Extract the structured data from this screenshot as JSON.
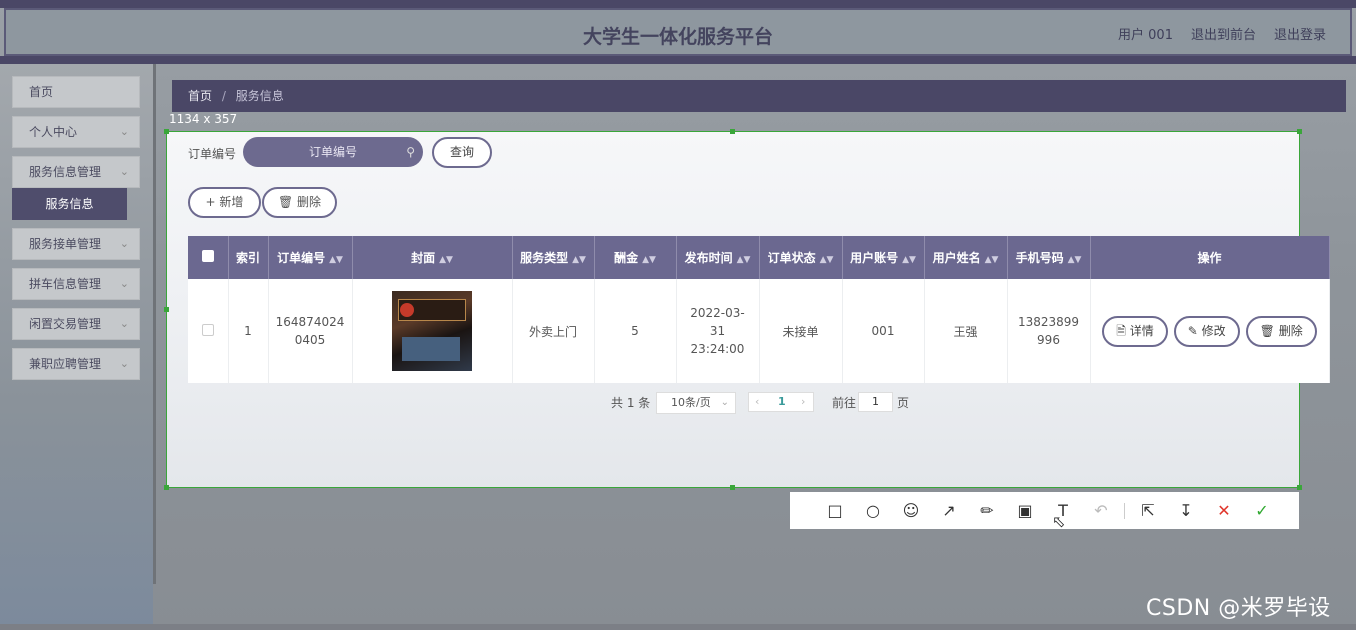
{
  "header": {
    "title": "大学生一体化服务平台",
    "user": "用户 001",
    "front": "退出到前台",
    "logout": "退出登录"
  },
  "sidebar": {
    "items": [
      {
        "label": "首页"
      },
      {
        "label": "个人中心"
      },
      {
        "label": "服务信息管理"
      },
      {
        "label": "服务信息"
      },
      {
        "label": "服务接单管理"
      },
      {
        "label": "拼车信息管理"
      },
      {
        "label": "闲置交易管理"
      },
      {
        "label": "兼职应聘管理"
      }
    ],
    "chevron": "chevron-down-icon"
  },
  "breadcrumb": {
    "home": "首页",
    "sep": "/",
    "current": "服务信息"
  },
  "capture": {
    "size_label": "1134 x 357"
  },
  "search": {
    "label": "订单编号",
    "placeholder": "订单编号",
    "query_label": "查询"
  },
  "actions": {
    "add_label": "新增",
    "delete_label": "删除"
  },
  "table": {
    "headers": [
      "索引",
      "订单编号",
      "封面",
      "服务类型",
      "酬金",
      "发布时间",
      "订单状态",
      "用户账号",
      "用户姓名",
      "手机号码",
      "操作"
    ],
    "rows": [
      {
        "index": "1",
        "order_no": "1648740240405",
        "cover": "store-photo",
        "service_type": "外卖上门",
        "reward": "5",
        "publish_time": "2022-03-31 23:24:00",
        "status": "未接单",
        "account": "001",
        "name": "王强",
        "phone": "13823899996",
        "ops": {
          "detail": "详情",
          "edit": "修改",
          "delete": "删除"
        }
      }
    ]
  },
  "pager": {
    "total": "共 1 条",
    "size": "10条/页",
    "current": "1",
    "goto": "前往",
    "goto_value": "1",
    "suffix": "页"
  },
  "toolbar": {
    "icons": [
      "rectangle-icon",
      "ellipse-icon",
      "emoji-icon",
      "arrow-icon",
      "pen-icon",
      "mosaic-icon",
      "text-icon",
      "undo-icon",
      "share-icon",
      "download-icon",
      "cancel-icon",
      "confirm-icon"
    ]
  },
  "watermark": "CSDN @米罗毕设",
  "colors": {
    "accent": "#6b6890",
    "dark": "#4a4766",
    "selection": "#3aa63a"
  }
}
